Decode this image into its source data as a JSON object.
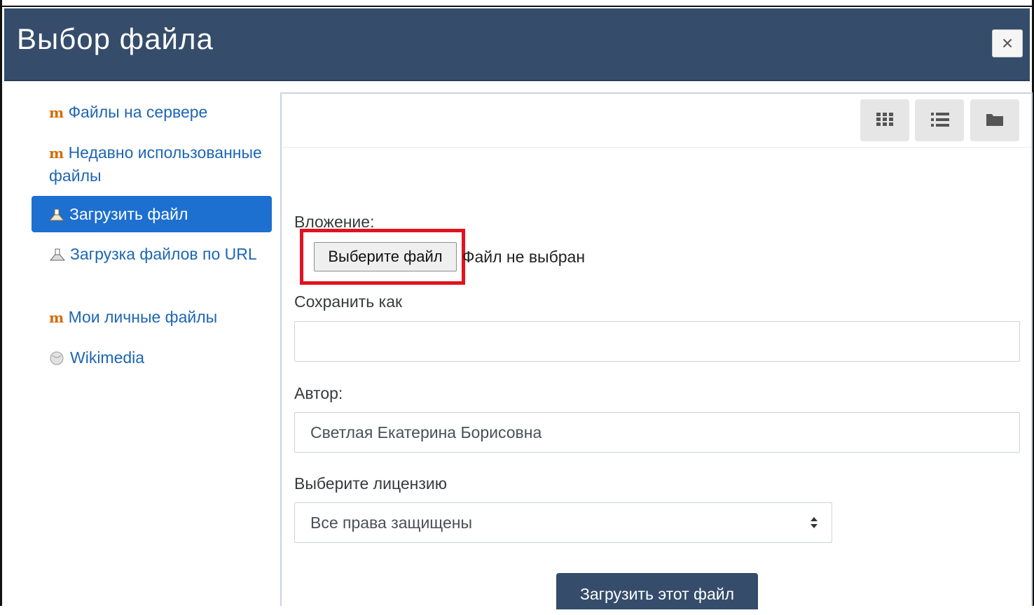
{
  "dialog": {
    "title": "Выбор файла",
    "close_symbol": "×"
  },
  "sidebar": {
    "items": [
      {
        "label": "Файлы на сервере",
        "icon": "moodle-icon"
      },
      {
        "label": "Недавно использованные файлы",
        "icon": "moodle-icon"
      },
      {
        "label": "Загрузить файл",
        "icon": "upload-icon",
        "active": true
      },
      {
        "label": "Загрузка файлов по URL",
        "icon": "url-download-icon"
      },
      {
        "label": "Мои личные файлы",
        "icon": "moodle-icon"
      },
      {
        "label": "Wikimedia",
        "icon": "wikimedia-icon"
      }
    ]
  },
  "toolbar": {
    "views": [
      "grid-view-icon",
      "list-view-icon",
      "folder-view-icon"
    ]
  },
  "form": {
    "attachment_label": "Вложение:",
    "choose_file_button": "Выберите файл",
    "no_file_text": "Файл не выбран",
    "save_as_label": "Сохранить как",
    "save_as_value": "",
    "author_label": "Автор:",
    "author_value": "Светлая Екатерина Борисовна",
    "license_label": "Выберите лицензию",
    "license_value": "Все права защищены",
    "submit_button": "Загрузить этот файл"
  },
  "colors": {
    "header_bg": "#354c6b",
    "active_item_bg": "#1d6fd0",
    "link": "#1d66b3",
    "highlight": "#e0131f"
  }
}
